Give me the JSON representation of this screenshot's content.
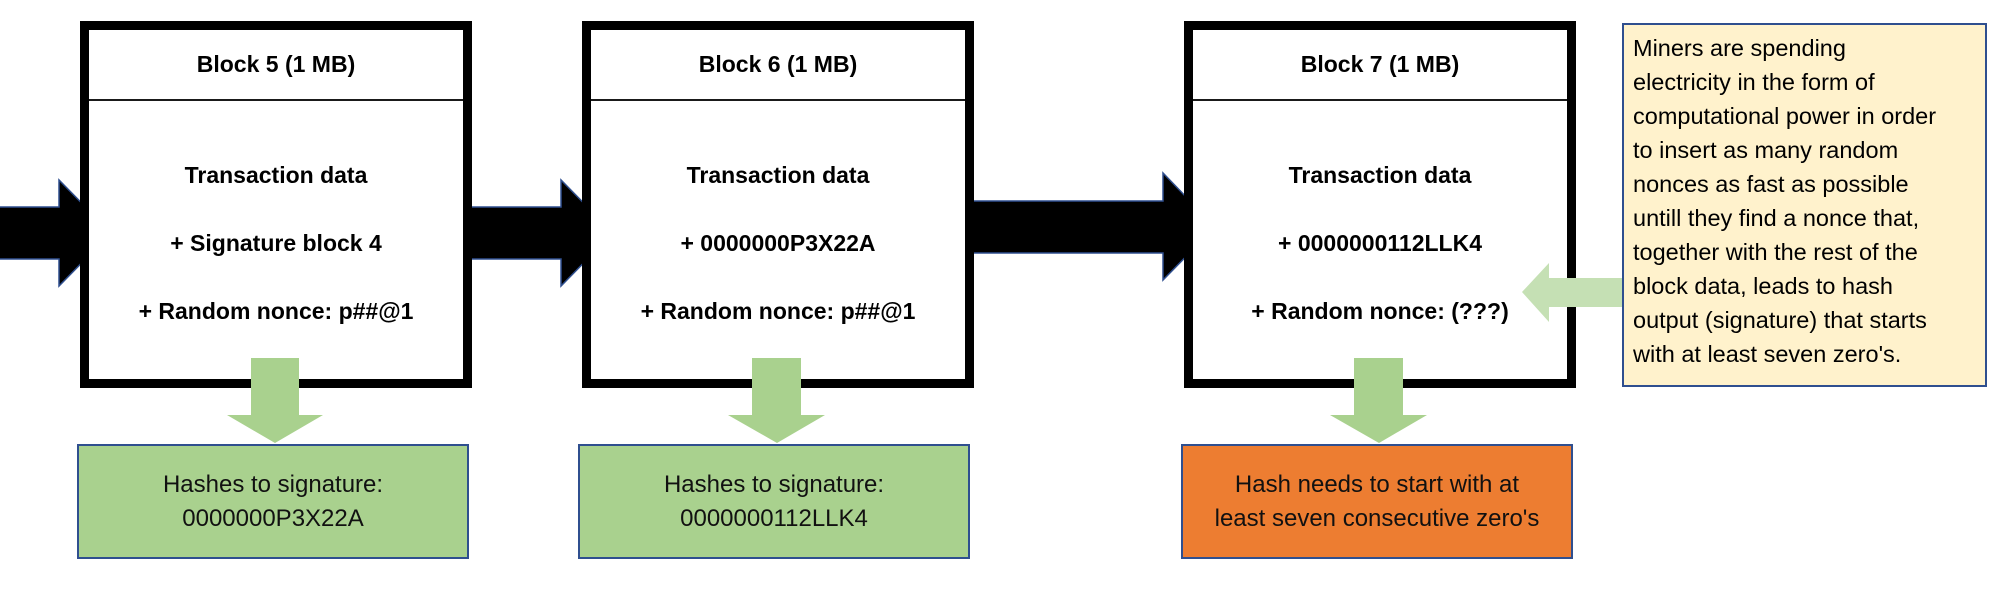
{
  "blocks": [
    {
      "title": "Block 5 (1 MB)",
      "line1": "Transaction data",
      "line2": "+ Signature block 4",
      "line3": "+ Random nonce: p##@1"
    },
    {
      "title": "Block 6 (1 MB)",
      "line1": "Transaction data",
      "line2": "+ 0000000P3X22A",
      "line3": "+ Random nonce: p##@1"
    },
    {
      "title": "Block 7 (1 MB)",
      "line1": "Transaction data",
      "line2": "+ 0000000112LLK4",
      "line3": "+ Random nonce: (???)"
    }
  ],
  "results": [
    {
      "line1": "Hashes to signature:",
      "line2": "0000000P3X22A",
      "status": "found"
    },
    {
      "line1": "Hashes to signature:",
      "line2": "0000000112LLK4",
      "status": "found"
    },
    {
      "line1": "Hash needs to start with at",
      "line2": "least seven consecutive zero's",
      "status": "pending"
    }
  ],
  "note": {
    "lines": [
      "Miners are spending",
      "electricity in the form of",
      "computational power in order",
      "to insert as many random",
      "nonces as fast as possible",
      "untill they find a nonce that,",
      "together with the rest of the",
      "block data, leads to hash",
      "output (signature) that starts",
      "with at least seven zero's."
    ]
  },
  "colors": {
    "found": "#a9d18e",
    "pending": "#ed7d31",
    "note_bg": "#fff2cc",
    "chain_arrow": "#000000",
    "hash_arrow": "#a9d18e",
    "note_arrow": "#c5e0b4",
    "outline": "#2f4f8f"
  }
}
